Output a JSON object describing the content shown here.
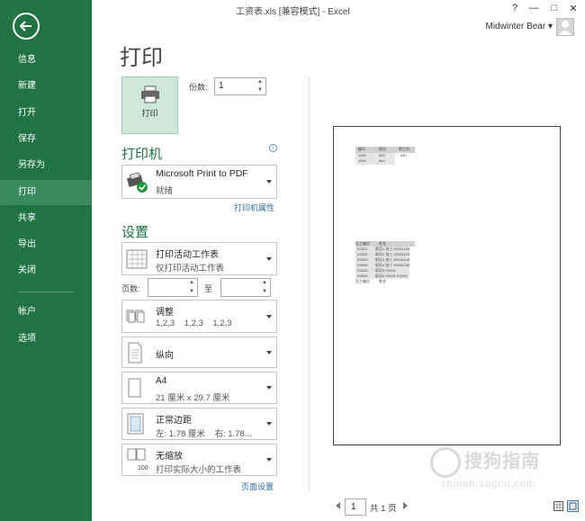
{
  "window": {
    "title": "工资表.xls [兼容模式] - Excel",
    "help": "?",
    "minimize": "—",
    "restore": "□",
    "close": "✕"
  },
  "user": {
    "name": "Midwinter Bear ▾"
  },
  "sidebar": {
    "items": [
      {
        "label": "信息"
      },
      {
        "label": "新建"
      },
      {
        "label": "打开"
      },
      {
        "label": "保存"
      },
      {
        "label": "另存为"
      },
      {
        "label": "打印"
      },
      {
        "label": "共享"
      },
      {
        "label": "导出"
      },
      {
        "label": "关闭"
      },
      {
        "label": "帐户"
      },
      {
        "label": "选项"
      }
    ],
    "active": "打印"
  },
  "page_title": "打印",
  "print_button": {
    "label": "打印"
  },
  "copies": {
    "label": "份数:",
    "value": "1"
  },
  "printer": {
    "heading": "打印机",
    "name": "Microsoft Print to PDF",
    "status": "就绪",
    "properties_link": "打印机属性"
  },
  "settings": {
    "heading": "设置",
    "scope": {
      "main": "打印活动工作表",
      "sub": "仅打印活动工作表"
    },
    "pages_label": "页数:",
    "to_label": "至",
    "collate": {
      "main": "调整",
      "sub": "1,2,3    1,2,3    1,2,3"
    },
    "orientation": {
      "main": "纵向"
    },
    "paper": {
      "main": "A4",
      "sub": "21 厘米 x 29.7 厘米"
    },
    "margins": {
      "main": "正常边距",
      "sub": "左: 1.78 厘米    右: 1.78..."
    },
    "scaling": {
      "main": "无缩放",
      "sub": "打印实际大小的工作表"
    },
    "page_setup_link": "页面设置"
  },
  "preview": {
    "table1": {
      "headers": [
        "编号",
        "职位",
        "职工所"
      ],
      "rows": [
        [
          "1000",
          "800",
          "640"
        ],
        [
          "1000",
          "840",
          ""
        ]
      ]
    },
    "table2": {
      "headers": [
        "员工编号",
        "姓名"
      ],
      "rows": [
        [
          "E0001",
          "职员1 张三 E0001129"
        ],
        [
          "E0002",
          "职员2 张三 E0001119"
        ],
        [
          "E0003",
          "职员3 张三 E0001149"
        ],
        [
          "E0004",
          "职员4 张三 E0001159"
        ],
        [
          "E0005",
          "职员5 E0001"
        ],
        [
          "E0006",
          "职员6 E0001 E0006"
        ]
      ],
      "footer": [
        "员工编号",
        "姓名"
      ]
    }
  },
  "pager": {
    "current": "1",
    "total": "共 1 页"
  },
  "watermark": {
    "main": "搜狗指南",
    "sub": "zhinan.sogou.com"
  }
}
